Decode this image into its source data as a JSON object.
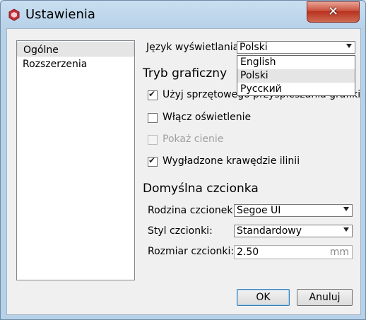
{
  "window": {
    "title": "Ustawienia",
    "close_glyph": "✕"
  },
  "sidebar": {
    "items": [
      {
        "label": "Ogólne"
      },
      {
        "label": "Rozszerzenia"
      }
    ]
  },
  "language": {
    "label": "Język wyświetlania:",
    "selected": "Polski",
    "options": [
      "English",
      "Polski",
      "Русский"
    ]
  },
  "graphics": {
    "title": "Tryb graficzny",
    "hw_accel": {
      "label": "Użyj sprzętowego przyspieszania grafiki",
      "checked": true
    },
    "lighting": {
      "label": "Włącz oświetlenie",
      "checked": false
    },
    "shadows": {
      "label": "Pokaż cienie",
      "checked": false,
      "disabled": true
    },
    "smooth": {
      "label": "Wygładzone krawędzie ilinii",
      "checked": true
    }
  },
  "font": {
    "title": "Domyślna czcionka",
    "family_label": "Rodzina czcionek:",
    "family_value": "Segoe UI",
    "style_label": "Styl czcionki:",
    "style_value": "Standardowy",
    "size_label": "Rozmiar czcionki:",
    "size_value": "2.50",
    "size_unit": "mm"
  },
  "buttons": {
    "ok": "OK",
    "cancel": "Anuluj"
  }
}
